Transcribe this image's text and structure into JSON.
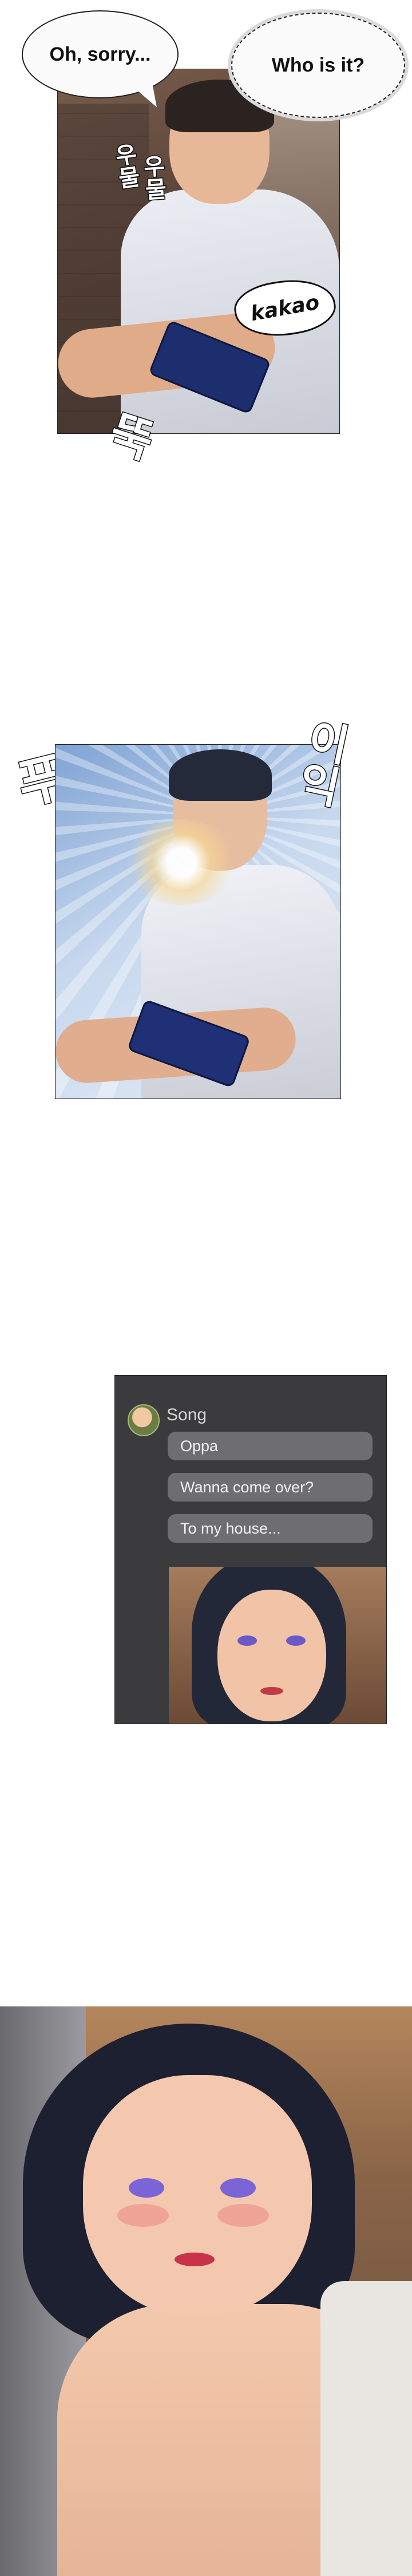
{
  "panel1": {
    "bubble_left": "Oh, sorry...",
    "bubble_right": "Who is it?",
    "sfx_vertical_1": "우물",
    "sfx_vertical_2": "우물",
    "sfx_phone": "kakao",
    "sfx_bottom": "뚝"
  },
  "panel2": {
    "sfx_left": "푸",
    "sfx_right": "이익"
  },
  "chat": {
    "sender": "Song",
    "messages": [
      "Oppa",
      "Wanna come over?",
      "To my house..."
    ]
  },
  "colors": {
    "chat_background": "#3b3b3d",
    "chat_bubble": "#6e6e71",
    "page_background": "#ffffff"
  }
}
